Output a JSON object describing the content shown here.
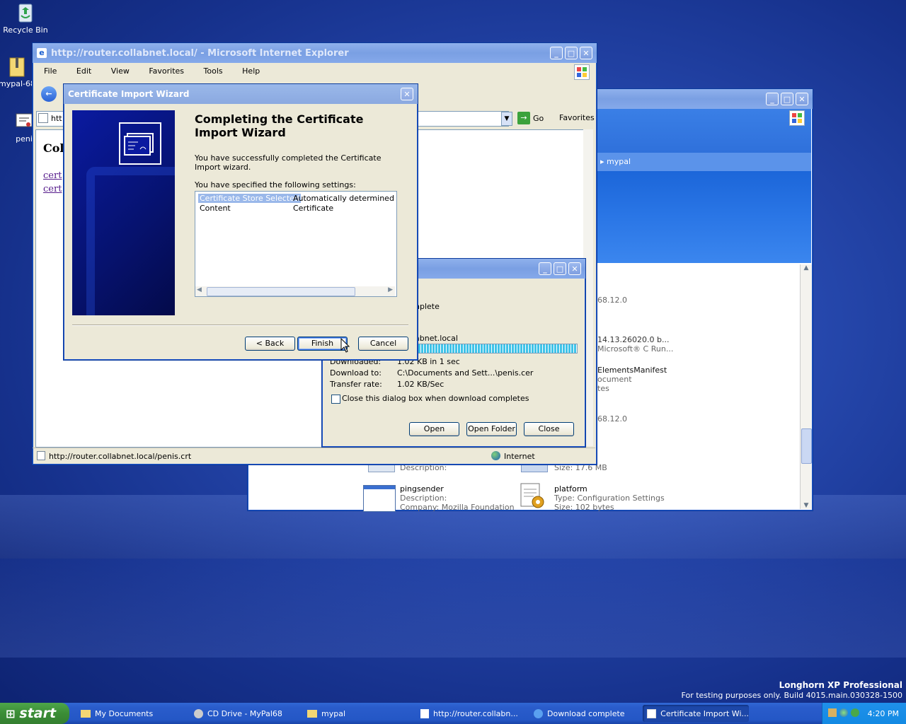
{
  "desktop": {
    "icons": [
      {
        "label": "Recycle Bin"
      },
      {
        "label": "mypal-68"
      },
      {
        "label": "peni"
      }
    ],
    "watermark": {
      "title": "Longhorn XP Professional",
      "subtitle": "For testing purposes only. Build 4015.main.030328-1500"
    }
  },
  "ie": {
    "title": "http://router.collabnet.local/ - Microsoft Internet Explorer",
    "menu": [
      "File",
      "Edit",
      "View",
      "Favorites",
      "Tools",
      "Help"
    ],
    "address_prefix": "htt",
    "go_label": "Go",
    "favorites_label": "Favorites",
    "page_heading": "Col",
    "links": [
      "cert",
      "cert"
    ],
    "status_url": "http://router.collabnet.local/penis.crt",
    "zone": "Internet"
  },
  "explorer": {
    "breadcrumb": "mypal",
    "list": [
      {
        "text": "68.12.0"
      },
      {
        "text": "14.13.26020.0 b..."
      },
      {
        "text": "Microsoft® C Run..."
      },
      {
        "text": "ElementsManifest"
      },
      {
        "text": "ocument"
      },
      {
        "text": "tes"
      },
      {
        "text": "68.12.0"
      }
    ],
    "files": [
      {
        "name": "pingsender",
        "line1": "Description:",
        "line2": "Company: Mozilla Foundation"
      },
      {
        "name": "platform",
        "line1": "Type: Configuration Settings",
        "line2": "Size: 102 bytes"
      }
    ],
    "partial": {
      "desc": "Description:",
      "size": "Size: 17.6 MB"
    }
  },
  "download": {
    "status_partial": "nplete",
    "source_partial": "abnet.local",
    "progress": 1.0,
    "downloaded_label": "Downloaded:",
    "downloaded_value": "1.02 KB in 1 sec",
    "download_to_label": "Download to:",
    "download_to_value": "C:\\Documents and Sett...\\penis.cer",
    "rate_label": "Transfer rate:",
    "rate_value": "1.02 KB/Sec",
    "close_checkbox": "Close this dialog box when download completes",
    "buttons": {
      "open": "Open",
      "open_folder": "Open Folder",
      "close": "Close"
    }
  },
  "wizard": {
    "title": "Certificate Import Wizard",
    "heading": "Completing the Certificate Import Wizard",
    "success": "You have successfully completed the Certificate Import wizard.",
    "specified": "You have specified the following settings:",
    "settings": [
      {
        "name": "Certificate Store Selected",
        "value": "Automatically determined by t"
      },
      {
        "name": "Content",
        "value": "Certificate"
      }
    ],
    "buttons": {
      "back": "< Back",
      "finish": "Finish",
      "cancel": "Cancel"
    }
  },
  "taskbar": {
    "start": "start",
    "tasks": [
      {
        "label": "My Documents"
      },
      {
        "label": "CD Drive - MyPal68"
      },
      {
        "label": "mypal"
      },
      {
        "label": "http://router.collabn..."
      },
      {
        "label": "Download complete"
      },
      {
        "label": "Certificate Import Wi..."
      }
    ],
    "clock": "4:20 PM"
  }
}
